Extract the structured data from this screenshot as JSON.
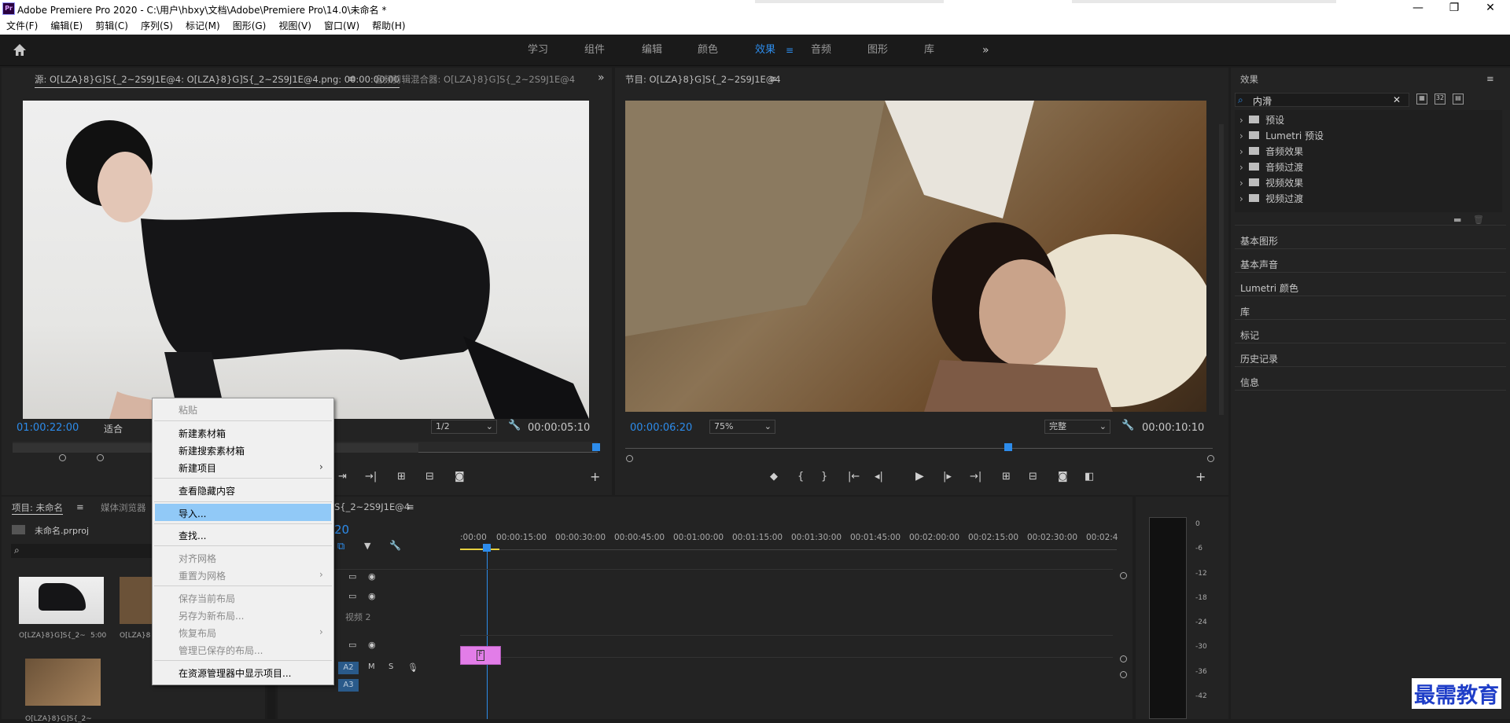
{
  "app": {
    "title": "Adobe Premiere Pro 2020 - C:\\用户\\hbxy\\文档\\Adobe\\Premiere Pro\\14.0\\未命名 *",
    "icon_label": "Pr",
    "win_min": "—",
    "win_max": "❐",
    "win_close": "✕"
  },
  "menubar": [
    "文件(F)",
    "编辑(E)",
    "剪辑(C)",
    "序列(S)",
    "标记(M)",
    "图形(G)",
    "视图(V)",
    "窗口(W)",
    "帮助(H)"
  ],
  "workspaces": {
    "items": [
      "学习",
      "组件",
      "编辑",
      "颜色",
      "效果",
      "音频",
      "图形",
      "库"
    ],
    "active": "效果",
    "more": "»"
  },
  "source": {
    "tab": "源: O[LZA}8}G]S{_2~2S9J1E@4: O[LZA}8}G]S{_2~2S9J1E@4.png: 00:00:00:00",
    "tab2": "音频剪辑混合器: O[LZA}8}G]S{_2~2S9J1E@4",
    "timecode": "01:00:22:00",
    "fit": "适合",
    "res": "1/2",
    "duration": "00:00:05:10"
  },
  "program": {
    "tab": "节目: O[LZA}8}G]S{_2~2S9J1E@4",
    "timecode": "00:00:06:20",
    "zoom": "75%",
    "quality": "完整",
    "duration": "00:00:10:10"
  },
  "effects": {
    "title": "效果",
    "search_value": "内滑",
    "tree": [
      "预设",
      "Lumetri 预设",
      "音频效果",
      "音频过渡",
      "视频效果",
      "视频过渡"
    ],
    "sections": [
      "基本图形",
      "基本声音",
      "Lumetri 颜色",
      "库",
      "标记",
      "历史记录",
      "信息"
    ]
  },
  "project": {
    "tab": "项目: 未命名",
    "tab2": "媒体浏览器",
    "file": "未命名.prproj",
    "items": [
      {
        "name": "O[LZA}8}G]S{_2~",
        "dur": "5:00"
      },
      {
        "name": "O[LZA}8",
        "dur": ""
      },
      {
        "name": "O[LZA}8}G]S{_2~",
        "dur": ""
      }
    ]
  },
  "timeline": {
    "tab": "S{_2~2S9J1E@4",
    "timecode": "20",
    "ticks": [
      ":00:00",
      "00:00:15:00",
      "00:00:30:00",
      "00:00:45:00",
      "00:01:00:00",
      "00:01:15:00",
      "00:01:30:00",
      "00:01:45:00",
      "00:02:00:00",
      "00:02:15:00",
      "00:02:30:00",
      "00:02:4"
    ],
    "track_label": "视频 2",
    "audio": [
      "A2",
      "A3"
    ]
  },
  "meter": {
    "labels": [
      "0",
      "-6",
      "-12",
      "-18",
      "-24",
      "-30",
      "-36",
      "-42"
    ]
  },
  "context_menu": {
    "items": [
      {
        "label": "粘贴",
        "disabled": true
      },
      {
        "label": "新建素材箱",
        "disabled": false
      },
      {
        "label": "新建搜索素材箱",
        "disabled": false
      },
      {
        "label": "新建项目",
        "disabled": false,
        "sub": true
      },
      {
        "label": "查看隐藏内容",
        "disabled": false
      },
      {
        "label": "导入...",
        "disabled": false,
        "highlight": true
      },
      {
        "label": "查找...",
        "disabled": false
      },
      {
        "label": "对齐网格",
        "disabled": true
      },
      {
        "label": "重置为网格",
        "disabled": true,
        "sub": true
      },
      {
        "label": "保存当前布局",
        "disabled": true
      },
      {
        "label": "另存为新布局...",
        "disabled": true
      },
      {
        "label": "恢复布局",
        "disabled": true,
        "sub": true
      },
      {
        "label": "管理已保存的布局...",
        "disabled": true
      },
      {
        "label": "在资源管理器中显示项目...",
        "disabled": false
      }
    ]
  },
  "watermark": "最需教育"
}
